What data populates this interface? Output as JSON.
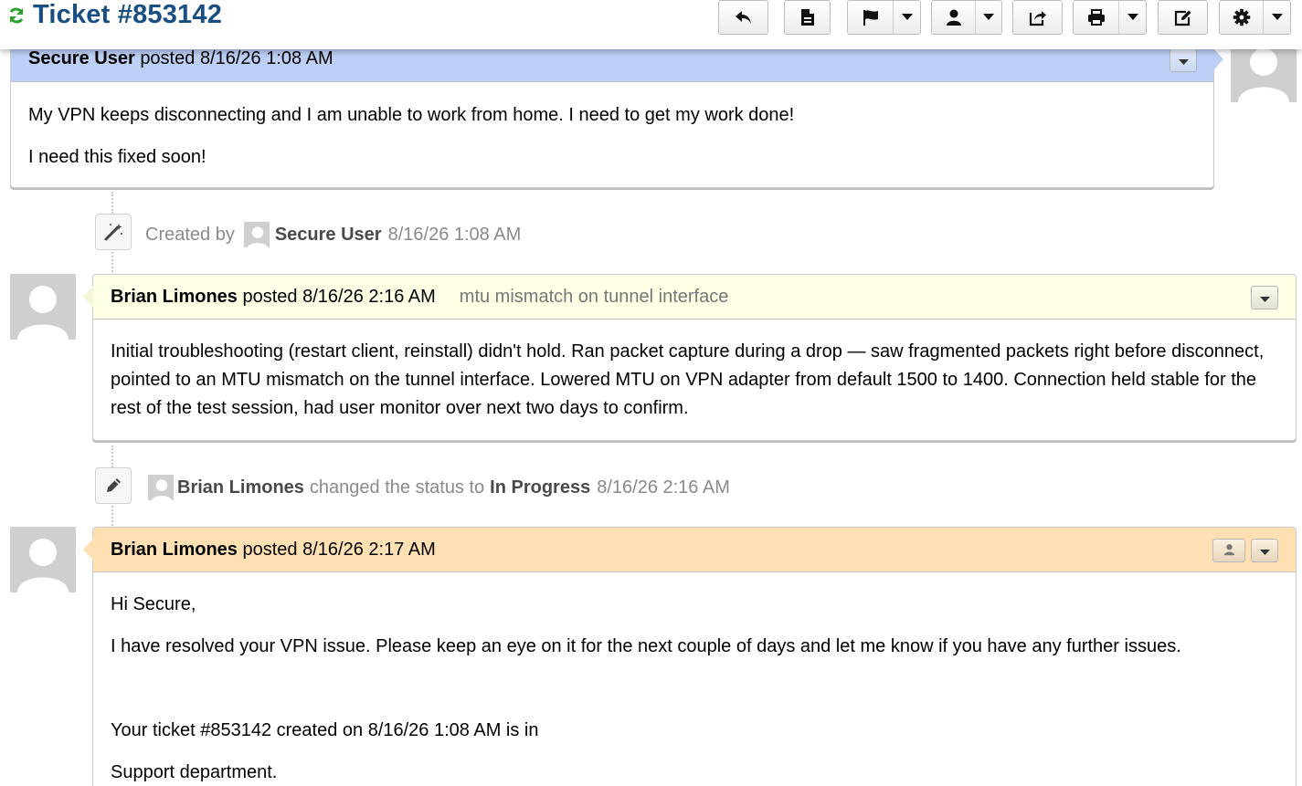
{
  "header": {
    "title": "Ticket #853142",
    "toolbar": [
      {
        "name": "reply-button",
        "icon": "reply-icon",
        "dropdown": false
      },
      {
        "name": "note-button",
        "icon": "note-icon",
        "dropdown": false
      },
      {
        "name": "flag-button",
        "icon": "flag-icon",
        "dropdown": true
      },
      {
        "name": "assign-button",
        "icon": "user-icon",
        "dropdown": true
      },
      {
        "name": "transfer-button",
        "icon": "share-icon",
        "dropdown": false
      },
      {
        "name": "print-button",
        "icon": "print-icon",
        "dropdown": true
      },
      {
        "name": "edit-button",
        "icon": "edit-icon",
        "dropdown": false
      },
      {
        "name": "settings-button",
        "icon": "gear-icon",
        "dropdown": true
      }
    ]
  },
  "thread": {
    "message1": {
      "author": "Secure User",
      "verb": "posted",
      "timestamp": "8/16/26 1:08 AM",
      "paragraphs": [
        "My VPN keeps disconnecting and I am unable to work from home. I need to get my work done!",
        "I need this fixed soon!"
      ],
      "header_color": "#BCD0F5"
    },
    "event1": {
      "prefix": "Created by",
      "who": "Secure User",
      "timestamp": "8/16/26 1:08 AM"
    },
    "note1": {
      "author": "Brian Limones",
      "verb": "posted",
      "timestamp": "8/16/26 2:16 AM",
      "subject": "mtu mismatch on tunnel interface",
      "body": "Initial troubleshooting (restart client, reinstall) didn't hold. Ran packet capture during a drop — saw fragmented packets right before disconnect, pointed to an MTU mismatch on the tunnel interface. Lowered MTU on VPN adapter from default 1500 to 1400. Connection held stable for the rest of the test session, had user monitor over next two days to confirm.",
      "header_color": "#FFFFE6"
    },
    "event2": {
      "who": "Brian Limones",
      "action": "changed the status to",
      "status": "In Progress",
      "timestamp": "8/16/26 2:16 AM"
    },
    "response1": {
      "author": "Brian Limones",
      "verb": "posted",
      "timestamp": "8/16/26 2:17 AM",
      "paragraphs": [
        "Hi Secure,",
        "I have resolved your VPN issue. Please keep an eye on it for the next couple of days and let me know if you have any further issues.",
        "",
        "Your ticket #853142 created on 8/16/26 1:08 AM is in",
        "Support department."
      ],
      "header_color": "#FFE0B3"
    }
  }
}
